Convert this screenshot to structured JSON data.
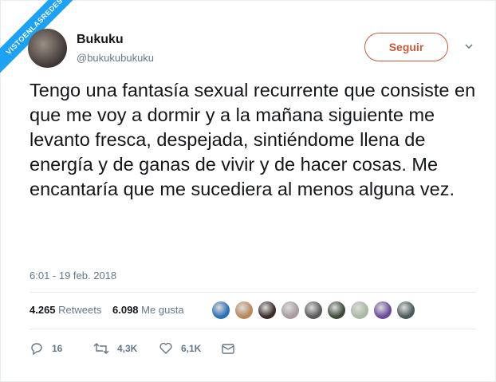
{
  "watermark": "VISTOENLASREDES",
  "author": {
    "name": "Bukuku",
    "handle": "@bukukubukuku"
  },
  "follow_label": "Seguir",
  "tweet_text": "Tengo una fantasía sexual recurrente que consiste en que me voy a dormir y a la mañana siguiente me levanto fresca, despejada, sintiéndome llena de energía y de ganas de vivir y de hacer cosas. Me encantaría que me sucediera al menos alguna vez.",
  "timestamp": "6:01 - 19 feb. 2018",
  "stats": {
    "retweets_count": "4.265",
    "retweets_label": "Retweets",
    "likes_count": "6.098",
    "likes_label": "Me gusta"
  },
  "liker_avatars": [
    "#2b6fb5",
    "#b8875a",
    "#3a2a2a",
    "#a89aa0",
    "#5a5a5a",
    "#3d4a3a",
    "#a8b8a0",
    "#6a4a9a",
    "#4a5a5a"
  ],
  "actions": {
    "replies": "16",
    "retweets": "4,3K",
    "likes": "6,1K"
  },
  "colors": {
    "follow_accent": "#c95a3a",
    "watermark_bg": "#1da1f2",
    "muted": "#657786"
  },
  "icons": [
    "chevron-down-icon",
    "reply-icon",
    "retweet-icon",
    "heart-icon",
    "mail-icon"
  ]
}
